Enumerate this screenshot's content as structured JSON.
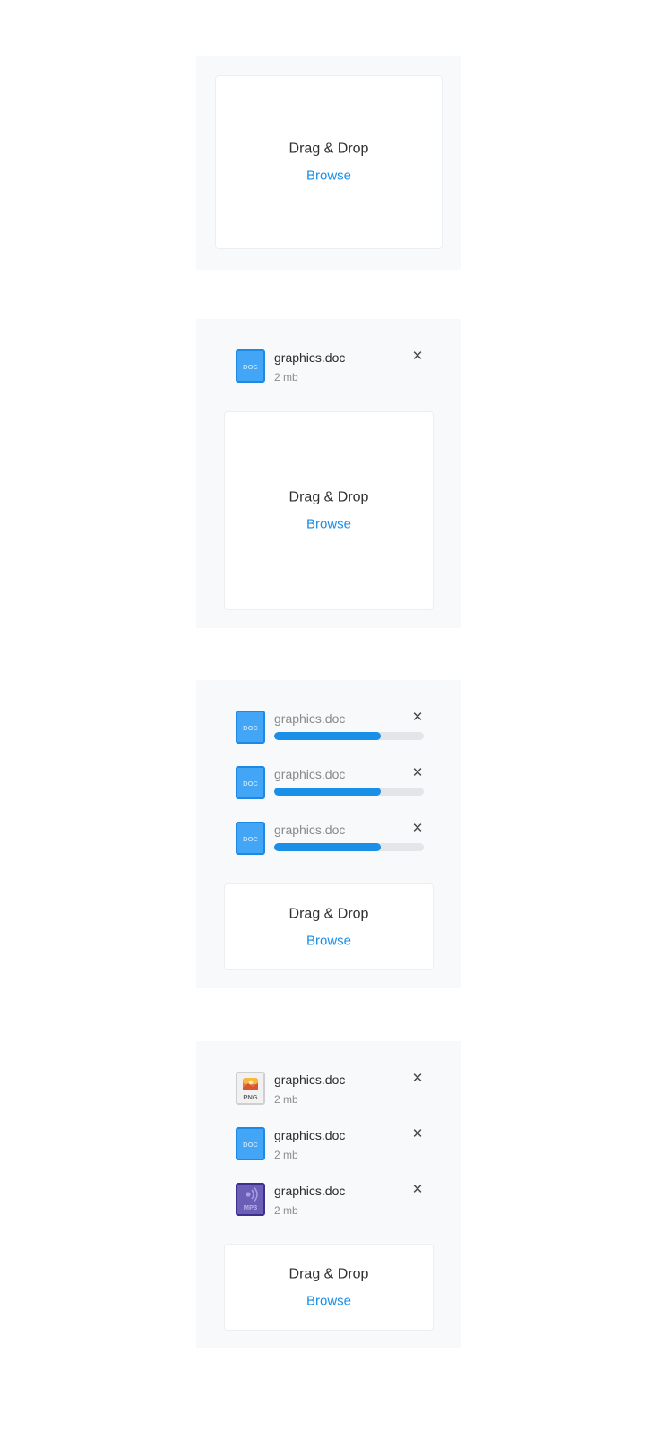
{
  "dropzone": {
    "title": "Drag & Drop",
    "browse": "Browse"
  },
  "colors": {
    "accent": "#1a8fe8",
    "doc_icon": "#42a5f5",
    "panel_bg": "#f8f9fb"
  },
  "panel2": {
    "files": [
      {
        "icon": "doc-file-icon",
        "icon_label": "DOC",
        "name": "graphics.doc",
        "size": "2 mb"
      }
    ]
  },
  "panel3": {
    "files": [
      {
        "icon": "doc-file-icon",
        "icon_label": "DOC",
        "name": "graphics.doc",
        "progress": 0.71
      },
      {
        "icon": "doc-file-icon",
        "icon_label": "DOC",
        "name": "graphics.doc",
        "progress": 0.71
      },
      {
        "icon": "doc-file-icon",
        "icon_label": "DOC",
        "name": "graphics.doc",
        "progress": 0.71
      }
    ]
  },
  "panel4": {
    "files": [
      {
        "icon": "png-file-icon",
        "icon_label": "PNG",
        "name": "graphics.doc",
        "size": "2 mb"
      },
      {
        "icon": "doc-file-icon",
        "icon_label": "DOC",
        "name": "graphics.doc",
        "size": "2 mb"
      },
      {
        "icon": "mp3-file-icon",
        "icon_label": "MP3",
        "name": "graphics.doc",
        "size": "2 mb"
      }
    ]
  },
  "remove_symbol": "✕"
}
